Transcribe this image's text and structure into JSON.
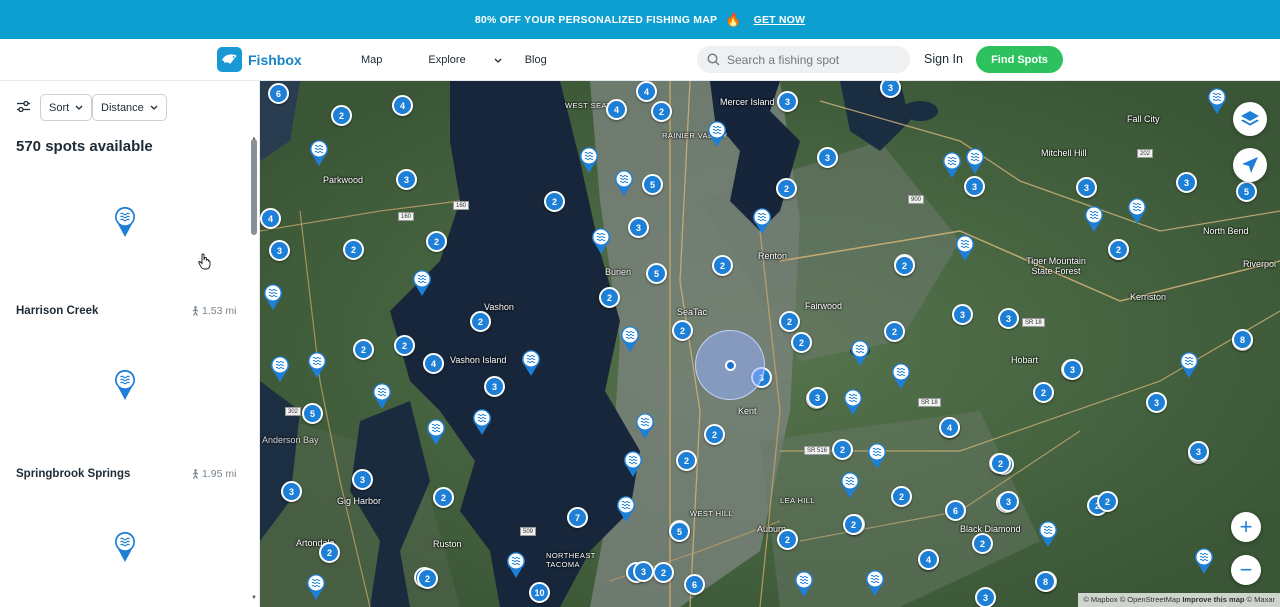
{
  "promo": {
    "text": "80% OFF YOUR PERSONALIZED FISHING MAP",
    "link": "GET NOW"
  },
  "header": {
    "brand": "Fishbox",
    "nav": [
      {
        "label": "Map"
      },
      {
        "label": "Explore"
      },
      {
        "label": "Blog"
      }
    ],
    "search_placeholder": "Search a fishing spot",
    "signin": "Sign In",
    "cta": "Find Spots"
  },
  "sidebar": {
    "sort_label": "Sort",
    "distance_label": "Distance",
    "count_text": "570 spots available",
    "spots": [
      {
        "name": "Harrison Creek",
        "distance": "1.53 mi"
      },
      {
        "name": "Springbrook Springs",
        "distance": "1.95 mi"
      }
    ]
  },
  "map": {
    "places": {
      "mercer_island": "Mercer Island",
      "west_seattle": "WEST SEATTLE",
      "rainier_valley": "RAINIER VALLEY",
      "parkwood": "Parkwood",
      "renton": "Renton",
      "burien": "Burien",
      "seatac": "SeaTac",
      "vashon": "Vashon",
      "vashon_island": "Vashon Island",
      "fairwood": "Fairwood",
      "kent": "Kent",
      "gig_harbor": "Gig Harbor",
      "lea_hill": "LEA HILL",
      "west_hill": "WEST HILL",
      "auburn": "Auburn",
      "ruston": "Ruston",
      "artondale": "Artondale",
      "northeast_tacoma": "NORTHEAST TACOMA",
      "black_diamond": "Black Diamond",
      "hobart": "Hobart",
      "tiger_mountain": "Tiger Mountain State Forest",
      "kerriston": "Kerriston",
      "north_bend": "North Bend",
      "riverpoint": "Riverpoi",
      "fall_city": "Fall City",
      "mitchell_hill": "Mitchell Hill",
      "anderson_bay": "Anderson Bay"
    },
    "clusters": [
      "6",
      "2",
      "4",
      "4",
      "2",
      "3",
      "4",
      "3",
      "2",
      "3",
      "2",
      "2",
      "2",
      "5",
      "5",
      "3",
      "2",
      "3",
      "3",
      "5",
      "2",
      "3",
      "2",
      "3",
      "3",
      "4",
      "3",
      "2",
      "2",
      "2",
      "2",
      "2",
      "2",
      "2",
      "4",
      "2",
      "3",
      "5",
      "2",
      "2",
      "2",
      "3",
      "2",
      "2",
      "4",
      "6",
      "3",
      "3",
      "3",
      "3",
      "6",
      "3",
      "2",
      "2",
      "3",
      "2",
      "5",
      "3",
      "2",
      "2",
      "2",
      "7",
      "5",
      "2",
      "2",
      "2",
      "2",
      "4",
      "2",
      "3",
      "3",
      "6",
      "2",
      "2",
      "2",
      "3",
      "4",
      "3",
      "10",
      "2",
      "3",
      "8",
      "3",
      "2",
      "3",
      "3",
      "4",
      "2",
      "8"
    ],
    "attribution": "© Mapbox © OpenStreetMap",
    "improve": "Improve this map",
    "maxar": "© Maxar"
  }
}
